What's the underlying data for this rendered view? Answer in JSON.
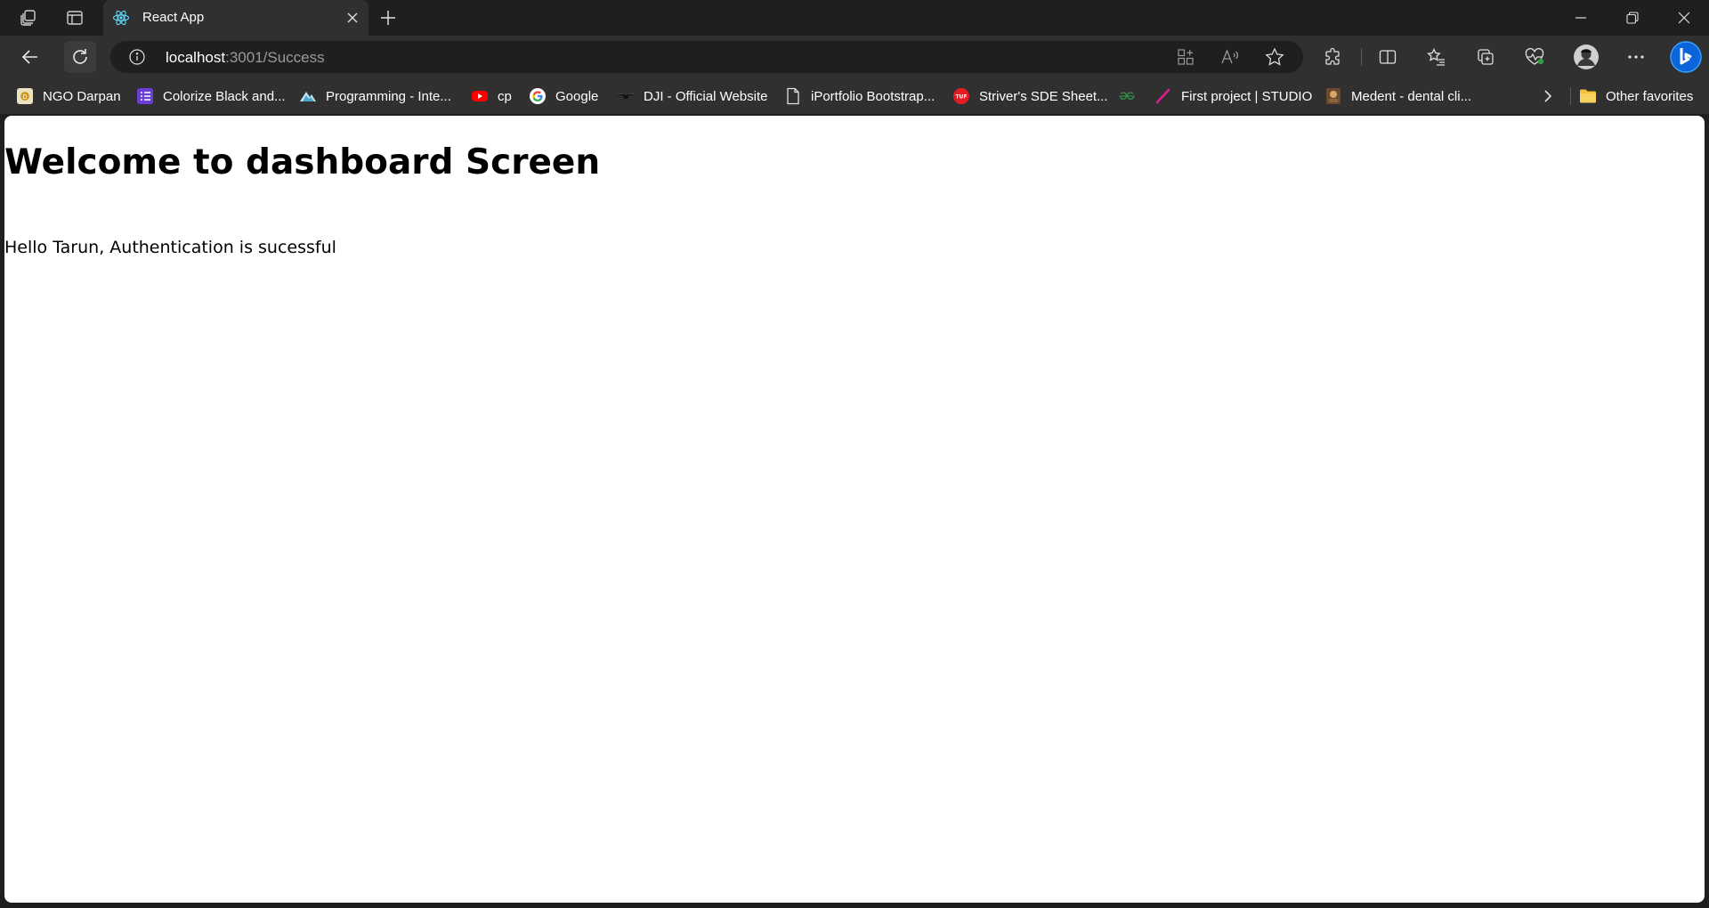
{
  "tab": {
    "title": "React App"
  },
  "address": {
    "host": "localhost",
    "path": ":3001/Success"
  },
  "favorites": [
    {
      "label": "NGO Darpan",
      "icon": "ngo-darpan-icon"
    },
    {
      "label": "Colorize Black and...",
      "icon": "list-icon"
    },
    {
      "label": "Programming - Inte...",
      "icon": "mountain-icon"
    },
    {
      "label": "cp",
      "icon": "youtube-icon"
    },
    {
      "label": "Google",
      "icon": "google-icon"
    },
    {
      "label": "DJI - Official Website",
      "icon": "dji-drone-icon"
    },
    {
      "label": "iPortfolio Bootstrap...",
      "icon": "page-icon"
    },
    {
      "label": "Striver's SDE Sheet...",
      "icon": "tuf-icon"
    },
    {
      "label": "",
      "icon": "gfg-icon"
    },
    {
      "label": "First project | STUDIO",
      "icon": "pen-icon"
    },
    {
      "label": "Medent - dental cli...",
      "icon": "medent-icon"
    }
  ],
  "other_favorites": {
    "label": "Other favorites"
  },
  "page": {
    "heading": "Welcome to dashboard Screen",
    "message": "Hello Tarun, Authentication is sucessful"
  },
  "colors": {
    "chrome_dark": "#1f1f1f",
    "chrome": "#303030",
    "page_bg": "#ffffff",
    "accent": "#0a66d8"
  }
}
